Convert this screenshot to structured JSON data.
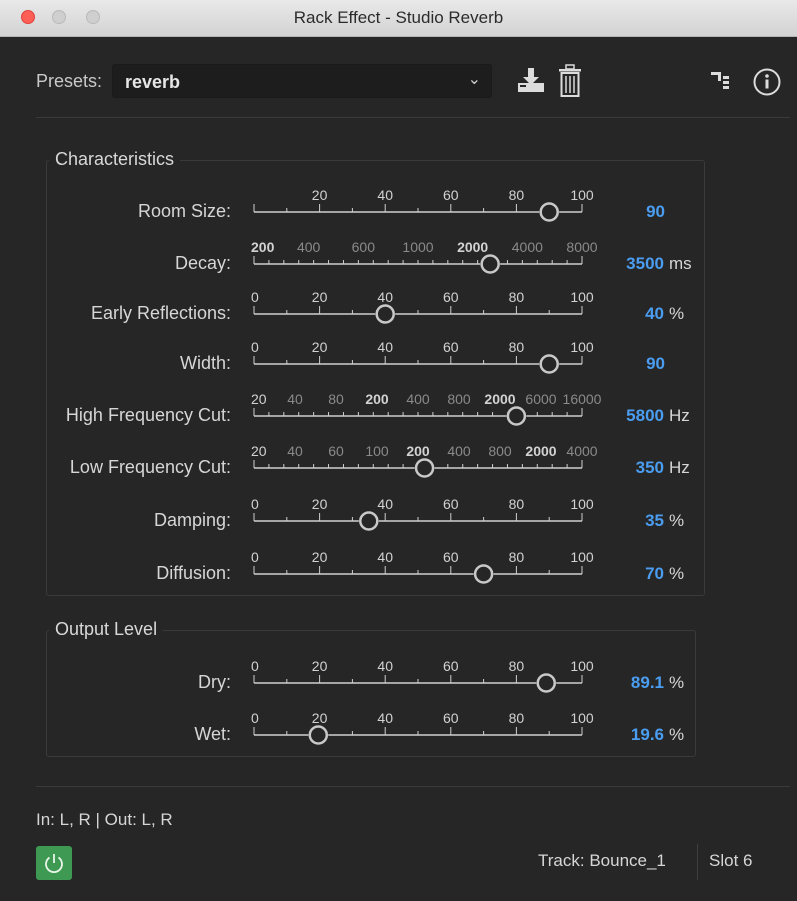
{
  "window": {
    "title": "Rack Effect - Studio Reverb"
  },
  "presets": {
    "label": "Presets:",
    "value": "reverb"
  },
  "icons": {
    "save": "save-preset-icon",
    "delete": "trash-icon",
    "routing": "channel-routing-icon",
    "info": "info-icon",
    "power": "power-icon"
  },
  "characteristics": {
    "title": "Characteristics",
    "params": [
      {
        "label": "Room Size:",
        "value": "90",
        "unit": "",
        "fraction": 0.9,
        "ticks": [
          "20",
          "40",
          "60",
          "80",
          "100"
        ]
      },
      {
        "label": "Decay:",
        "value": "3500",
        "unit": "ms",
        "fraction": 0.72,
        "ticks": [
          "200",
          "400",
          "600",
          "1000",
          "2000",
          "4000",
          "8000"
        ]
      },
      {
        "label": "Early Reflections:",
        "value": "40",
        "unit": "%",
        "fraction": 0.4,
        "ticks": [
          "0",
          "20",
          "40",
          "60",
          "80",
          "100"
        ]
      },
      {
        "label": "Width:",
        "value": "90",
        "unit": "",
        "fraction": 0.9,
        "ticks": [
          "0",
          "20",
          "40",
          "60",
          "80",
          "100"
        ]
      },
      {
        "label": "High Frequency Cut:",
        "value": "5800",
        "unit": "Hz",
        "fraction": 0.8,
        "ticks": [
          "20",
          "40",
          "80",
          "200",
          "400",
          "800",
          "2000",
          "6000",
          "16000"
        ]
      },
      {
        "label": "Low Frequency Cut:",
        "value": "350",
        "unit": "Hz",
        "fraction": 0.52,
        "ticks": [
          "20",
          "40",
          "60",
          "100",
          "200",
          "400",
          "800",
          "2000",
          "4000"
        ]
      },
      {
        "label": "Damping:",
        "value": "35",
        "unit": "%",
        "fraction": 0.35,
        "ticks": [
          "0",
          "20",
          "40",
          "60",
          "80",
          "100"
        ]
      },
      {
        "label": "Diffusion:",
        "value": "70",
        "unit": "%",
        "fraction": 0.7,
        "ticks": [
          "0",
          "20",
          "40",
          "60",
          "80",
          "100"
        ]
      }
    ]
  },
  "output": {
    "title": "Output Level",
    "params": [
      {
        "label": "Dry:",
        "value": "89.1",
        "unit": "%",
        "fraction": 0.891,
        "ticks": [
          "0",
          "20",
          "40",
          "60",
          "80",
          "100"
        ]
      },
      {
        "label": "Wet:",
        "value": "19.6",
        "unit": "%",
        "fraction": 0.196,
        "ticks": [
          "0",
          "20",
          "40",
          "60",
          "80",
          "100"
        ]
      }
    ]
  },
  "footer": {
    "io": "In: L, R | Out: L, R",
    "track": "Track: Bounce_1",
    "slot": "Slot 6"
  },
  "colors": {
    "accent": "#4a9df0",
    "power": "#3e9a52",
    "close": "#fd5f57"
  }
}
